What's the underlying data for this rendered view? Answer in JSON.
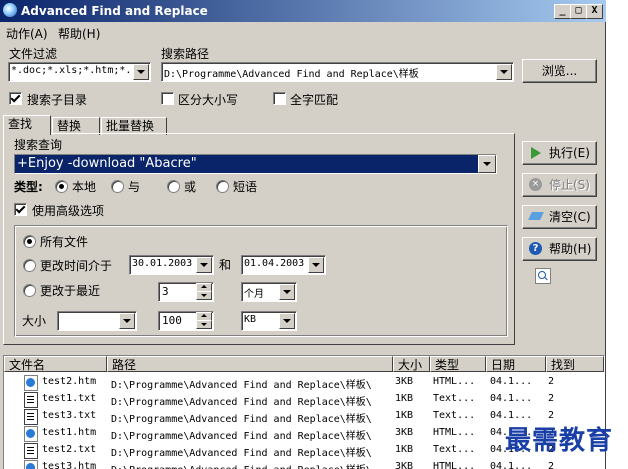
{
  "window": {
    "title": "Advanced Find and Replace",
    "controls": {
      "minimize": "_",
      "maximize": "□",
      "close": "X"
    }
  },
  "menu": {
    "items": [
      "动作(A)",
      "帮助(H)"
    ]
  },
  "filter": {
    "label": "文件过滤",
    "value": "*.doc;*.xls;*.htm;*."
  },
  "search_path": {
    "label": "搜索路径",
    "value": "D:\\Programme\\Advanced Find and Replace\\样板",
    "browse_label": "浏览..."
  },
  "options": {
    "subdirs": {
      "label": "搜索子目录",
      "checked": true
    },
    "case": {
      "label": "区分大小写",
      "checked": false
    },
    "whole_word": {
      "label": "全字匹配",
      "checked": false
    }
  },
  "tabs": [
    "查找",
    "替换",
    "批量替换"
  ],
  "query": {
    "label": "搜索查询",
    "value": "+Enjoy -download \"Abacre\""
  },
  "type": {
    "label": "类型:",
    "options": [
      "本地",
      "与",
      "或",
      "短语"
    ],
    "selected": "本地"
  },
  "advanced": {
    "label": "使用高级选项",
    "checked": true,
    "all_files": "所有文件",
    "modified_between": "更改时间介于",
    "date_from": "30.01.2003",
    "and_label": "和",
    "date_to": "01.04.2003",
    "modified_recent": "更改于最近",
    "recent_value": "3",
    "recent_unit": "个月",
    "size_label": "大小",
    "size_op": "",
    "size_value": "100",
    "size_unit": "KB",
    "selected": "所有文件"
  },
  "actions": {
    "run": "执行(E)",
    "stop": "停止(S)",
    "clear": "清空(C)",
    "help": "帮助(H)"
  },
  "results": {
    "columns": [
      "文件名",
      "路径",
      "大小",
      "类型",
      "日期",
      "找到"
    ],
    "rows": [
      {
        "name": "test2.htm",
        "path": "D:\\Programme\\Advanced Find and Replace\\样板\\",
        "size": "3KB",
        "type": "HTML...",
        "date": "04.1...",
        "found": "2",
        "icon": "html-file-icon"
      },
      {
        "name": "test1.txt",
        "path": "D:\\Programme\\Advanced Find and Replace\\样板\\",
        "size": "1KB",
        "type": "Text...",
        "date": "04.1...",
        "found": "2",
        "icon": "text-file-icon"
      },
      {
        "name": "test3.txt",
        "path": "D:\\Programme\\Advanced Find and Replace\\样板\\",
        "size": "1KB",
        "type": "Text...",
        "date": "04.1...",
        "found": "2",
        "icon": "text-file-icon"
      },
      {
        "name": "test1.htm",
        "path": "D:\\Programme\\Advanced Find and Replace\\样板\\",
        "size": "3KB",
        "type": "HTML...",
        "date": "04.1...",
        "found": "2",
        "icon": "html-file-icon"
      },
      {
        "name": "test2.txt",
        "path": "D:\\Programme\\Advanced Find and Replace\\样板\\",
        "size": "1KB",
        "type": "Text...",
        "date": "04.1...",
        "found": "2",
        "icon": "text-file-icon"
      },
      {
        "name": "test3.htm",
        "path": "D:\\Programme\\Advanced Find and Replace\\样板\\",
        "size": "3KB",
        "type": "HTML...",
        "date": "04.1...",
        "found": "2",
        "icon": "html-file-icon"
      }
    ]
  },
  "watermark": "最需教育",
  "colors": {
    "titlebar": "#0a246a",
    "selection": "#0a246a",
    "face": "#d4d0c8",
    "watermark": "#1a3fa6"
  }
}
